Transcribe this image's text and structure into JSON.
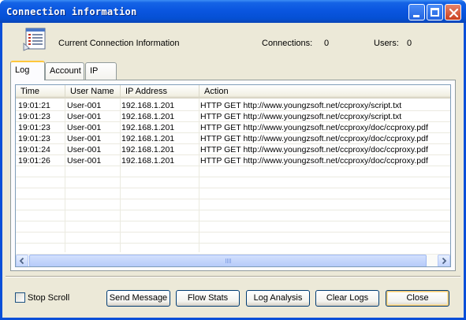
{
  "window": {
    "title": "Connection information"
  },
  "header": {
    "title": "Current Connection Information",
    "connections_label": "Connections:",
    "connections_value": "0",
    "users_label": "Users:",
    "users_value": "0"
  },
  "tabs": [
    {
      "label": "Log",
      "selected": true
    },
    {
      "label": "Account",
      "selected": false
    },
    {
      "label": "IP",
      "selected": false
    }
  ],
  "table": {
    "columns": [
      "Time",
      "User Name",
      "IP Address",
      "Action"
    ],
    "rows": [
      {
        "time": "19:01:21",
        "user": "User-001",
        "ip": "192.168.1.201",
        "action": "HTTP GET http://www.youngzsoft.net/ccproxy/script.txt"
      },
      {
        "time": "19:01:23",
        "user": "User-001",
        "ip": "192.168.1.201",
        "action": "HTTP GET http://www.youngzsoft.net/ccproxy/script.txt"
      },
      {
        "time": "19:01:23",
        "user": "User-001",
        "ip": "192.168.1.201",
        "action": "HTTP GET http://www.youngzsoft.net/ccproxy/doc/ccproxy.pdf"
      },
      {
        "time": "19:01:23",
        "user": "User-001",
        "ip": "192.168.1.201",
        "action": "HTTP GET http://www.youngzsoft.net/ccproxy/doc/ccproxy.pdf"
      },
      {
        "time": "19:01:24",
        "user": "User-001",
        "ip": "192.168.1.201",
        "action": "HTTP GET http://www.youngzsoft.net/ccproxy/doc/ccproxy.pdf"
      },
      {
        "time": "19:01:26",
        "user": "User-001",
        "ip": "192.168.1.201",
        "action": "HTTP GET http://www.youngzsoft.net/ccproxy/doc/ccproxy.pdf"
      }
    ]
  },
  "footer": {
    "stop_scroll_label": "Stop Scroll",
    "stop_scroll_checked": false,
    "buttons": {
      "send_message": "Send Message",
      "flow_stats": "Flow Stats",
      "log_analysis": "Log Analysis",
      "clear_logs": "Clear Logs",
      "close": "Close"
    }
  },
  "colors": {
    "titlebar": "#0a56e0",
    "client_bg": "#ece9d8",
    "tab_highlight": "#ffc73c",
    "close_button": "#c9401f"
  }
}
